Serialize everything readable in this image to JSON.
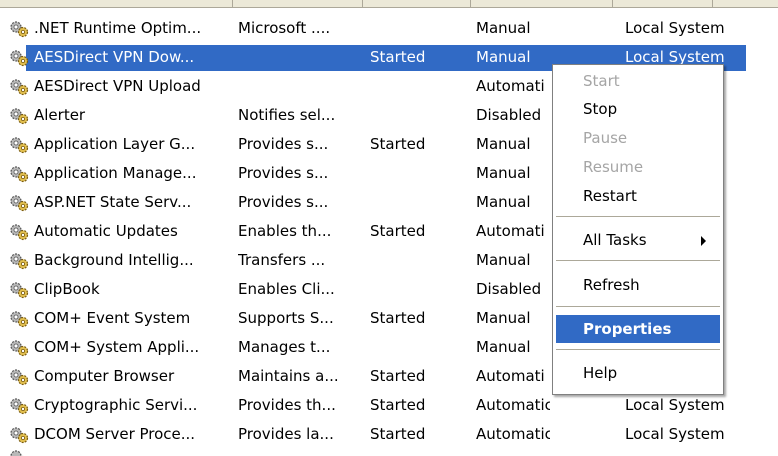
{
  "services": [
    {
      "name": ".NET Runtime Optim...",
      "description": "Microsoft ....",
      "status": "",
      "startup": "Manual",
      "logon": "Local System"
    },
    {
      "name": "AESDirect VPN Dow...",
      "description": "",
      "status": "Started",
      "startup": "Manual",
      "logon": "Local System"
    },
    {
      "name": "AESDirect VPN Upload",
      "description": "",
      "status": "",
      "startup": "Automati",
      "logon": ""
    },
    {
      "name": "Alerter",
      "description": "Notifies sel...",
      "status": "",
      "startup": "Disabled",
      "logon": ""
    },
    {
      "name": "Application Layer G...",
      "description": "Provides s...",
      "status": "Started",
      "startup": "Manual",
      "logon": ""
    },
    {
      "name": "Application Manage...",
      "description": "Provides s...",
      "status": "",
      "startup": "Manual",
      "logon": ""
    },
    {
      "name": "ASP.NET State Serv...",
      "description": "Provides s...",
      "status": "",
      "startup": "Manual",
      "logon": ""
    },
    {
      "name": "Automatic Updates",
      "description": "Enables th...",
      "status": "Started",
      "startup": "Automati",
      "logon": ""
    },
    {
      "name": "Background Intellig...",
      "description": "Transfers ...",
      "status": "",
      "startup": "Manual",
      "logon": ""
    },
    {
      "name": "ClipBook",
      "description": "Enables Cli...",
      "status": "",
      "startup": "Disabled",
      "logon": ""
    },
    {
      "name": "COM+ Event System",
      "description": "Supports S...",
      "status": "Started",
      "startup": "Manual",
      "logon": ""
    },
    {
      "name": "COM+ System Appli...",
      "description": "Manages t...",
      "status": "",
      "startup": "Manual",
      "logon": ""
    },
    {
      "name": "Computer Browser",
      "description": "Maintains a...",
      "status": "Started",
      "startup": "Automati",
      "logon": ""
    },
    {
      "name": "Cryptographic Servi...",
      "description": "Provides th...",
      "status": "Started",
      "startup": "Automatic",
      "logon": "Local System"
    },
    {
      "name": "DCOM Server Proce...",
      "description": "Provides la...",
      "status": "Started",
      "startup": "Automatic",
      "logon": "Local System"
    }
  ],
  "context_menu": {
    "start": "Start",
    "stop": "Stop",
    "pause": "Pause",
    "resume": "Resume",
    "restart": "Restart",
    "all_tasks": "All Tasks",
    "refresh": "Refresh",
    "properties": "Properties",
    "help": "Help"
  },
  "colors": {
    "selection": "#316ac5",
    "disabled_text": "#a5a5a5"
  },
  "icons": {
    "service": "gears-icon",
    "submenu": "submenu-arrow-icon"
  }
}
